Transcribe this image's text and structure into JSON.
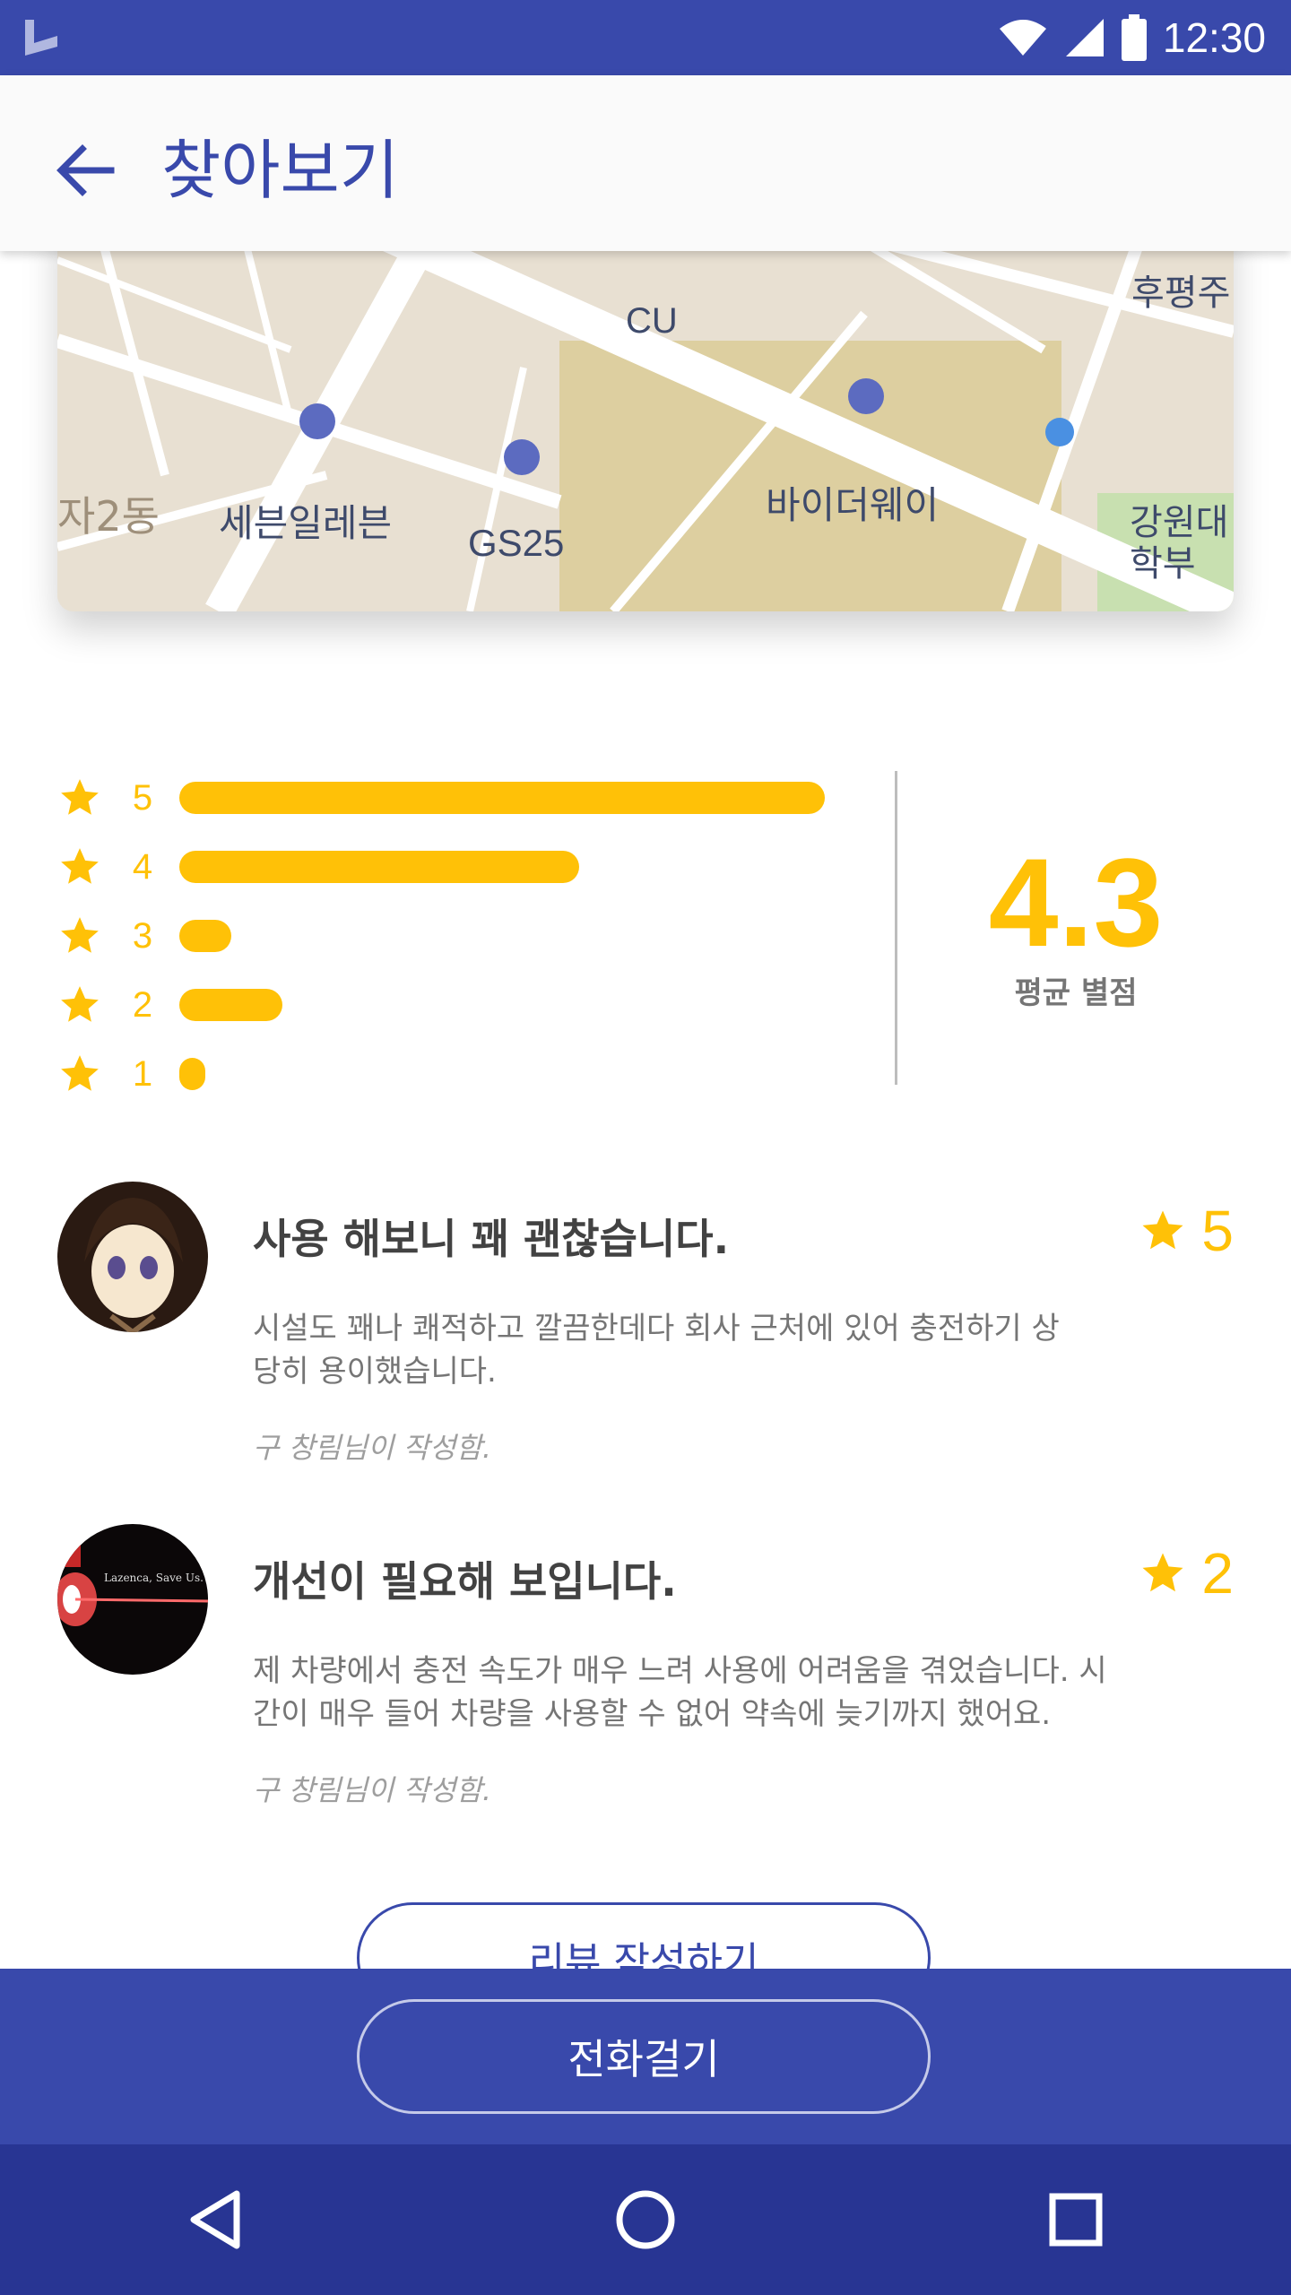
{
  "status_bar": {
    "time": "12:30"
  },
  "app_bar": {
    "title": "찾아보기"
  },
  "map": {
    "labels": [
      "CU",
      "후평주",
      "세븐일레븐",
      "GS25",
      "바이더웨이",
      "자2동",
      "강원대학부",
      "GS25"
    ]
  },
  "ratings": {
    "rows": [
      {
        "stars": "5",
        "fraction": 1.0
      },
      {
        "stars": "4",
        "fraction": 0.62
      },
      {
        "stars": "3",
        "fraction": 0.08
      },
      {
        "stars": "2",
        "fraction": 0.16
      },
      {
        "stars": "1",
        "fraction": 0.04
      }
    ],
    "average": "4.3",
    "average_label": "평균 별점"
  },
  "reviews": [
    {
      "title": "사용 해보니 꽤 괜찮습니다.",
      "score": "5",
      "body": "시설도 꽤나 쾌적하고 깔끔한데다 회사 근처에 있어 충전하기 상당히 용이했습니다.",
      "author": "구 창림님이 작성함."
    },
    {
      "title": "개선이 필요해 보입니다.",
      "score": "2",
      "body": "제 차량에서 충전 속도가 매우 느려 사용에 어려움을 겪었습니다. 시간이 매우 들어 차량을 사용할 수 없어 약속에 늦기까지 했어요.",
      "author": "구 창림님이 작성함."
    }
  ],
  "buttons": {
    "write_review": "리뷰 작성하기",
    "call": "전화걸기"
  },
  "colors": {
    "primary": "#3949ab",
    "primary_dark": "#283593",
    "accent": "#ffc107"
  },
  "icons": {
    "back": "arrow-left-icon",
    "star": "star-icon",
    "nav_back": "triangle-back-icon",
    "nav_home": "circle-home-icon",
    "nav_recents": "square-recents-icon"
  }
}
